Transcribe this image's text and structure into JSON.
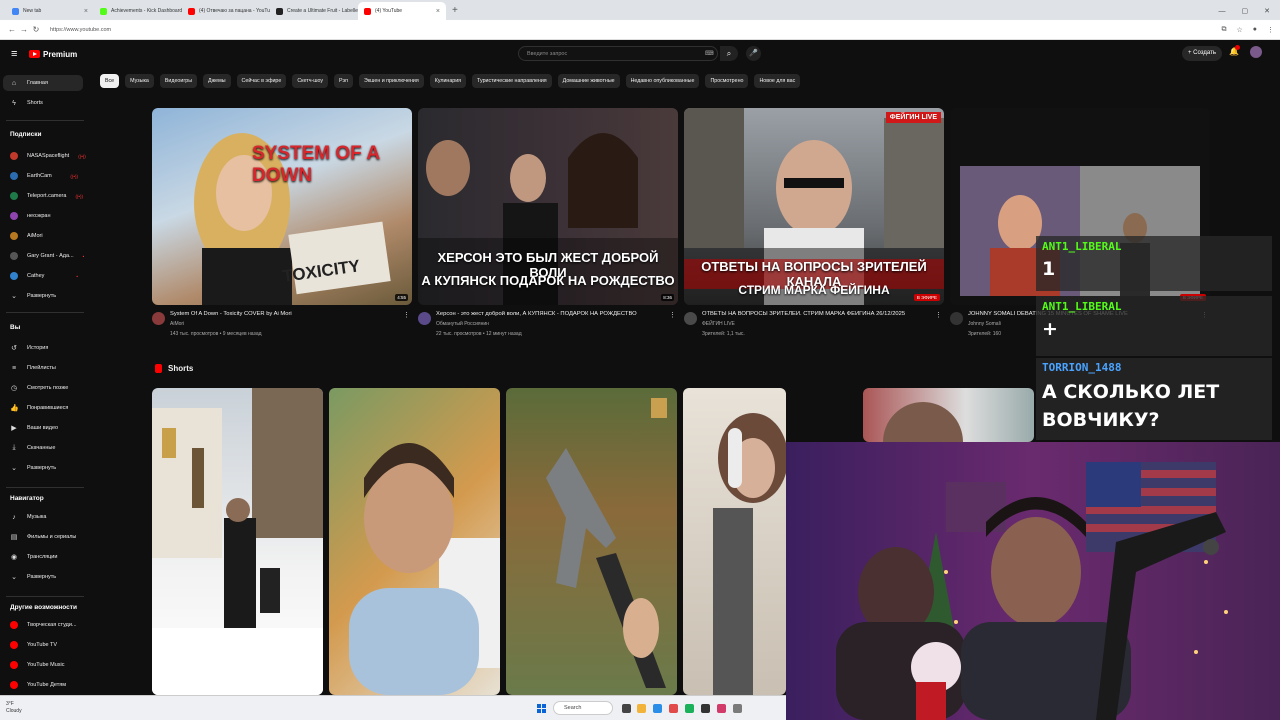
{
  "browser": {
    "tabs": [
      {
        "title": "New tab",
        "color": "#4285f4",
        "active": false
      },
      {
        "title": "Achievements - Kick Dashboard",
        "color": "#53fc18",
        "active": false
      },
      {
        "title": "(4) Отвечаю за пацана - YouTube",
        "color": "#ff0000",
        "active": false
      },
      {
        "title": "Create a Ultimate Fruit - Labelled",
        "color": "#222222",
        "active": false
      },
      {
        "title": "(4) YouTube",
        "color": "#ff0000",
        "active": true
      }
    ],
    "url": "https://www.youtube.com"
  },
  "youtube": {
    "logo": "Premium",
    "search_placeholder": "Введите запрос",
    "create_label": "Создать",
    "chips": [
      "Все",
      "Музыка",
      "Видеоигры",
      "Джемы",
      "Сейчас в эфире",
      "Скетч-шоу",
      "Рэп",
      "Экшен и приключения",
      "Кулинария",
      "Туристические направления",
      "Домашние животные",
      "Недавно опубликованные",
      "Просмотрено",
      "Новое для вас"
    ],
    "sidebar": {
      "main": [
        {
          "label": "Главная",
          "icon": "home-icon",
          "glyph": "⌂"
        },
        {
          "label": "Shorts",
          "icon": "shorts-icon",
          "glyph": "ϟ"
        }
      ],
      "subs_title": "Подписки",
      "subs": [
        {
          "label": "NASASpaceflight",
          "color": "#c0392b",
          "live": "((•))"
        },
        {
          "label": "EarthCam",
          "color": "#2b6cb0",
          "live": "((•))"
        },
        {
          "label": "Teleport.camera",
          "color": "#1f7a4a",
          "live": "((•))"
        },
        {
          "label": "неоэкран",
          "color": "#8e44ad",
          "live": ""
        },
        {
          "label": "AiMori",
          "color": "#b7791f",
          "live": ""
        },
        {
          "label": "Gary Grant - Ада...",
          "color": "#555555",
          "live": "•"
        },
        {
          "label": "Cathey",
          "color": "#3182ce",
          "live": "•"
        }
      ],
      "expand1": "Развернуть",
      "you_title": "Вы",
      "you": [
        {
          "label": "История",
          "icon": "history-icon",
          "glyph": "↺"
        },
        {
          "label": "Плейлисты",
          "icon": "playlists-icon",
          "glyph": "≡"
        },
        {
          "label": "Смотреть позже",
          "icon": "watch-later-icon",
          "glyph": "◷"
        },
        {
          "label": "Понравившиеся",
          "icon": "like-icon",
          "glyph": "👍"
        },
        {
          "label": "Ваши видео",
          "icon": "your-videos-icon",
          "glyph": "▶"
        },
        {
          "label": "Скачанные",
          "icon": "download-icon",
          "glyph": "⤓"
        },
        {
          "label": "Развернуть",
          "icon": "chevron-down-icon",
          "glyph": "⌄"
        }
      ],
      "nav_title": "Навигатор",
      "nav": [
        {
          "label": "Музыка",
          "icon": "music-icon",
          "glyph": "♪"
        },
        {
          "label": "Фильмы и сериалы",
          "icon": "film-icon",
          "glyph": "▤"
        },
        {
          "label": "Трансляции",
          "icon": "live-icon",
          "glyph": "◉"
        },
        {
          "label": "Развернуть",
          "icon": "chevron-down-icon",
          "glyph": "⌄"
        }
      ],
      "more_title": "Другие возможности",
      "more": [
        {
          "label": "Творческая студи...",
          "color": "#ff0000"
        },
        {
          "label": "YouTube TV",
          "color": "#ff0000"
        },
        {
          "label": "YouTube Music",
          "color": "#ff0000"
        },
        {
          "label": "YouTube Детям",
          "color": "#ff0000"
        }
      ]
    },
    "videos": [
      {
        "title": "System Of A Down - Toxicity COVER by Ai Mori",
        "channel": "AiMori",
        "stats": "143 тыс. просмотров • 9 месяцев назад",
        "duration": "4:55",
        "thumb_top": "SYSTEM OF A DOWN",
        "thumb_bottom": "TOXICITY",
        "badge": ""
      },
      {
        "title": "Херсон - это жест доброй воли, А КУПЯНСК - ПОДАРОК НА РОЖДЕСТВО",
        "channel": "Обманутый Россиянин",
        "stats": "22 тыс. просмотров • 12 минут назад",
        "duration": "8:36",
        "thumb_top": "ХЕРСОН ЭТО БЫЛ ЖЕСТ ДОБРОЙ ВОЛИ",
        "thumb_bottom": "А КУПЯНСК ПОДАРОК НА РОЖДЕСТВО",
        "badge": ""
      },
      {
        "title": "ОТВЕТЫ НА ВОПРОСЫ ЗРИТЕЛЕЙ. СТРИМ МАРКА ФЕЙГИНА 26/12/2025",
        "channel": "ФЕЙГИН LIVE",
        "stats": "Зрителей: 1,1 тыс.",
        "duration": "В ЭФИРЕ",
        "thumb_top": "ОТВЕТЫ НА ВОПРОСЫ ЗРИТЕЛЕЙ КАНАЛА",
        "thumb_bottom": "СТРИМ МАРКА ФЕЙГИНА",
        "badge": "ФЕЙГИН LIVE"
      },
      {
        "title": "JOHNNY SOMALI DEBATING 15 MINUTES OF SHAME LIVE",
        "channel": "Johnny Somali",
        "stats": "Зрителей: 160",
        "duration": "В ЭФИРЕ",
        "thumb_top": "",
        "thumb_bottom": "",
        "badge": ""
      }
    ],
    "shorts_title": "Shorts"
  },
  "chat_overlay": [
    {
      "user": "ANT1_LIBERAL",
      "text": "1",
      "user_color": "#53fc18"
    },
    {
      "user": "ANT1_LIBERAL",
      "text": "+",
      "user_color": "#53fc18"
    },
    {
      "user": "TORRION_1488",
      "text": "А СКОЛЬКО ЛЕТ ВОВЧИКУ?",
      "user_color": "#4aa3ff"
    }
  ],
  "taskbar": {
    "weather_temp": "3°F",
    "weather_desc": "Cloudy",
    "search": "Search"
  }
}
